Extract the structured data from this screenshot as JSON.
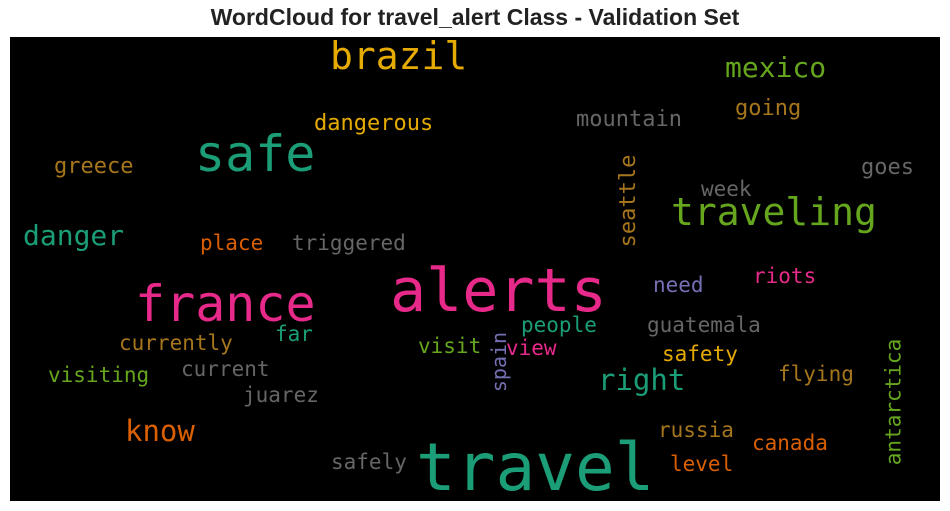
{
  "chart_data": {
    "type": "wordcloud",
    "title": "WordCloud for travel_alert Class - Validation Set",
    "background": "#000000",
    "words": [
      {
        "text": "alerts",
        "color": "#e7298a",
        "orientation": "horizontal"
      },
      {
        "text": "travel",
        "color": "#1b9e77",
        "orientation": "horizontal"
      },
      {
        "text": "france",
        "color": "#e7298a",
        "orientation": "horizontal"
      },
      {
        "text": "safe",
        "color": "#1b9e77",
        "orientation": "horizontal"
      },
      {
        "text": "brazil",
        "color": "#e6ab02",
        "orientation": "horizontal"
      },
      {
        "text": "traveling",
        "color": "#66a61e",
        "orientation": "horizontal"
      },
      {
        "text": "mexico",
        "color": "#66a61e",
        "orientation": "horizontal"
      },
      {
        "text": "danger",
        "color": "#1b9e77",
        "orientation": "horizontal"
      },
      {
        "text": "know",
        "color": "#d95f02",
        "orientation": "horizontal"
      },
      {
        "text": "right",
        "color": "#1b9e77",
        "orientation": "horizontal"
      },
      {
        "text": "dangerous",
        "color": "#e6ab02",
        "orientation": "horizontal"
      },
      {
        "text": "mountain",
        "color": "#666666",
        "orientation": "horizontal"
      },
      {
        "text": "going",
        "color": "#a6761d",
        "orientation": "horizontal"
      },
      {
        "text": "greece",
        "color": "#a6761d",
        "orientation": "horizontal"
      },
      {
        "text": "goes",
        "color": "#666666",
        "orientation": "horizontal"
      },
      {
        "text": "week",
        "color": "#666666",
        "orientation": "horizontal"
      },
      {
        "text": "seattle",
        "color": "#a6761d",
        "orientation": "vertical"
      },
      {
        "text": "place",
        "color": "#d95f02",
        "orientation": "horizontal"
      },
      {
        "text": "triggered",
        "color": "#666666",
        "orientation": "horizontal"
      },
      {
        "text": "riots",
        "color": "#e7298a",
        "orientation": "horizontal"
      },
      {
        "text": "need",
        "color": "#7570b3",
        "orientation": "horizontal"
      },
      {
        "text": "people",
        "color": "#1b9e77",
        "orientation": "horizontal"
      },
      {
        "text": "guatemala",
        "color": "#666666",
        "orientation": "horizontal"
      },
      {
        "text": "far",
        "color": "#1b9e77",
        "orientation": "horizontal"
      },
      {
        "text": "currently",
        "color": "#a6761d",
        "orientation": "horizontal"
      },
      {
        "text": "visit",
        "color": "#66a61e",
        "orientation": "horizontal"
      },
      {
        "text": "view",
        "color": "#e7298a",
        "orientation": "horizontal"
      },
      {
        "text": "spain",
        "color": "#7570b3",
        "orientation": "vertical"
      },
      {
        "text": "safety",
        "color": "#e6ab02",
        "orientation": "horizontal"
      },
      {
        "text": "antarctica",
        "color": "#66a61e",
        "orientation": "vertical"
      },
      {
        "text": "visiting",
        "color": "#66a61e",
        "orientation": "horizontal"
      },
      {
        "text": "current",
        "color": "#666666",
        "orientation": "horizontal"
      },
      {
        "text": "flying",
        "color": "#a6761d",
        "orientation": "horizontal"
      },
      {
        "text": "juarez",
        "color": "#666666",
        "orientation": "horizontal"
      },
      {
        "text": "russia",
        "color": "#a6761d",
        "orientation": "horizontal"
      },
      {
        "text": "canada",
        "color": "#d95f02",
        "orientation": "horizontal"
      },
      {
        "text": "level",
        "color": "#d95f02",
        "orientation": "horizontal"
      },
      {
        "text": "safely",
        "color": "#666666",
        "orientation": "horizontal"
      }
    ]
  }
}
